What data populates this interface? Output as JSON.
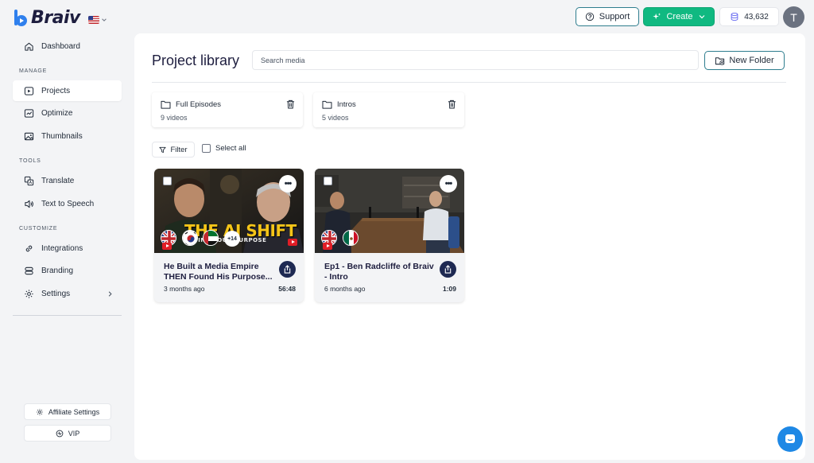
{
  "brand": {
    "name": "Braiv"
  },
  "sidebar": {
    "top_item": {
      "label": "Dashboard"
    },
    "sections": {
      "manage": "MANAGE",
      "tools": "TOOLS",
      "customize": "CUSTOMIZE"
    },
    "items": {
      "projects": "Projects",
      "optimize": "Optimize",
      "thumbnails": "Thumbnails",
      "translate": "Translate",
      "tts": "Text to Speech",
      "integrations": "Integrations",
      "branding": "Branding",
      "settings": "Settings"
    },
    "active_item": "Projects",
    "footer": {
      "affiliate": "Affiliate Settings",
      "vip": "VIP"
    }
  },
  "topbar": {
    "support": "Support",
    "create": "Create",
    "credits": "43,632",
    "avatar_initial": "T"
  },
  "main": {
    "title": "Project library",
    "search_placeholder": "Search media",
    "new_folder": "New Folder",
    "folders": [
      {
        "name": "Full Episodes",
        "count": "9 videos"
      },
      {
        "name": "Intros",
        "count": "5 videos"
      }
    ],
    "filter": "Filter",
    "select_all": "Select all",
    "videos": [
      {
        "title": "He Built a Media Empire THEN Found His Purpose...",
        "age": "3 months ago",
        "duration": "56:48",
        "thumb_title": "THE AI SHIFT",
        "thumb_subtitle": "FIND YOUR PURPOSE",
        "extra_languages": "+14",
        "more": "•••"
      },
      {
        "title": "Ep1 - Ben Radcliffe of Braiv - Intro",
        "age": "6 months ago",
        "duration": "1:09",
        "more": "•••"
      }
    ]
  },
  "colors": {
    "accent_teal": "#2e7d8e",
    "create_green": "#10b981",
    "navy": "#1e2952",
    "chat_blue": "#1e88e5"
  }
}
